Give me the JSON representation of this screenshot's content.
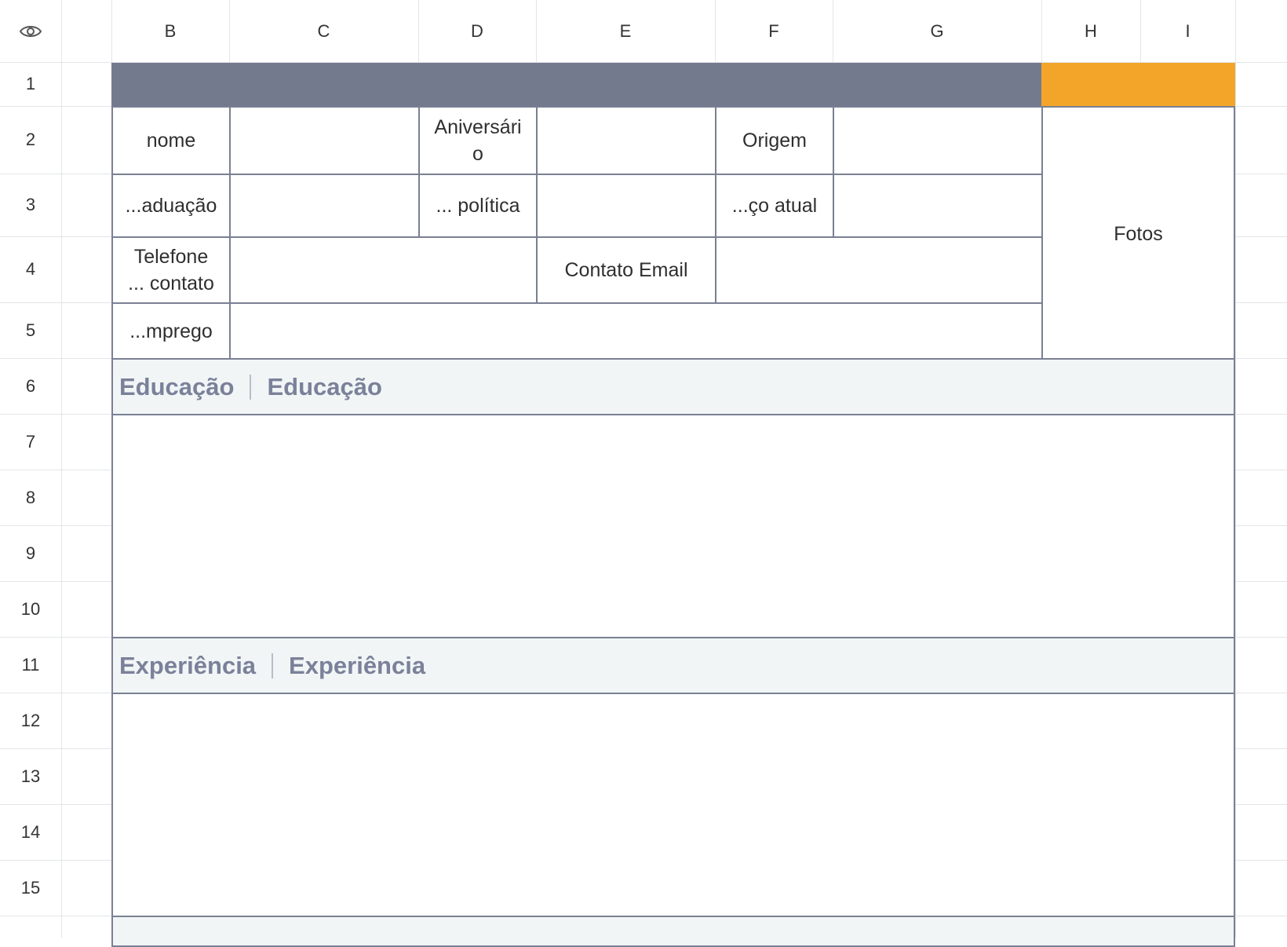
{
  "columns": [
    "B",
    "C",
    "D",
    "E",
    "F",
    "G",
    "H",
    "I"
  ],
  "rows": [
    "1",
    "2",
    "3",
    "4",
    "5",
    "6",
    "7",
    "8",
    "9",
    "10",
    "11",
    "12",
    "13",
    "14",
    "15"
  ],
  "colors": {
    "header_banner": "#737a8d",
    "accent_banner": "#f3a52a",
    "section_bg": "#f1f5f6",
    "section_text": "#7b8199",
    "border": "#7a8093"
  },
  "form": {
    "nome_label": "nome",
    "aniversario_label": "Aniversári\no",
    "origem_label": "Origem",
    "graduacao_label": "...aduação",
    "politica_label": "... política",
    "endereco_label": "...ço atual",
    "telefone_label": "Telefone\n... contato",
    "email_label": "Contato Email",
    "emprego_label": "...mprego",
    "fotos_label": "Fotos"
  },
  "sections": {
    "educacao": {
      "label": "Educação",
      "label2": "Educação"
    },
    "experiencia": {
      "label": "Experiência",
      "label2": "Experiência"
    }
  }
}
